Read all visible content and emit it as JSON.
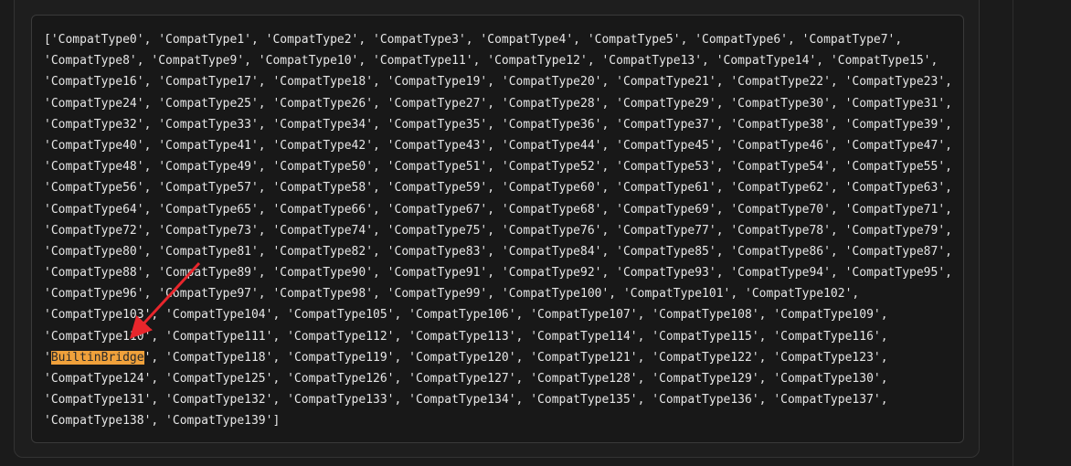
{
  "header": {
    "partial_title": ""
  },
  "output": {
    "lines": [
      "['CompatType0', 'CompatType1', 'CompatType2', 'CompatType3', 'CompatType4', 'CompatType5', 'CompatType6', 'CompatType7',",
      "'CompatType8', 'CompatType9', 'CompatType10', 'CompatType11', 'CompatType12', 'CompatType13', 'CompatType14', 'CompatType15',",
      "'CompatType16', 'CompatType17', 'CompatType18', 'CompatType19', 'CompatType20', 'CompatType21', 'CompatType22', 'CompatType23',",
      "'CompatType24', 'CompatType25', 'CompatType26', 'CompatType27', 'CompatType28', 'CompatType29', 'CompatType30', 'CompatType31',",
      "'CompatType32', 'CompatType33', 'CompatType34', 'CompatType35', 'CompatType36', 'CompatType37', 'CompatType38', 'CompatType39',",
      "'CompatType40', 'CompatType41', 'CompatType42', 'CompatType43', 'CompatType44', 'CompatType45', 'CompatType46', 'CompatType47',",
      "'CompatType48', 'CompatType49', 'CompatType50', 'CompatType51', 'CompatType52', 'CompatType53', 'CompatType54', 'CompatType55',",
      "'CompatType56', 'CompatType57', 'CompatType58', 'CompatType59', 'CompatType60', 'CompatType61', 'CompatType62', 'CompatType63',",
      "'CompatType64', 'CompatType65', 'CompatType66', 'CompatType67', 'CompatType68', 'CompatType69', 'CompatType70', 'CompatType71',",
      "'CompatType72', 'CompatType73', 'CompatType74', 'CompatType75', 'CompatType76', 'CompatType77', 'CompatType78', 'CompatType79',",
      "'CompatType80', 'CompatType81', 'CompatType82', 'CompatType83', 'CompatType84', 'CompatType85', 'CompatType86', 'CompatType87',",
      "'CompatType88', 'CompatType89', 'CompatType90', 'CompatType91', 'CompatType92', 'CompatType93', 'CompatType94', 'CompatType95',",
      "'CompatType96', 'CompatType97', 'CompatType98', 'CompatType99', 'CompatType100', 'CompatType101', 'CompatType102',",
      "'CompatType103', 'CompatType104', 'CompatType105', 'CompatType106', 'CompatType107', 'CompatType108', 'CompatType109',",
      "'CompatType110', 'CompatType111', 'CompatType112', 'CompatType113', 'CompatType114', 'CompatType115', 'CompatType116',",
      "'BuiltinBridge', 'CompatType118', 'CompatType119', 'CompatType120', 'CompatType121', 'CompatType122', 'CompatType123',",
      "'CompatType124', 'CompatType125', 'CompatType126', 'CompatType127', 'CompatType128', 'CompatType129', 'CompatType130',",
      "'CompatType131', 'CompatType132', 'CompatType133', 'CompatType134', 'CompatType135', 'CompatType136', 'CompatType137',",
      "'CompatType138', 'CompatType139']"
    ],
    "highlighted_text": "BuiltinBridge"
  },
  "annotation": {
    "arrow_icon": "red-arrow-icon",
    "arrow_color": "#e8262c"
  },
  "colors": {
    "background": "#1b1b1b",
    "output_background": "#181818",
    "text": "#e6e6e6",
    "highlight": "#f0a13b"
  }
}
